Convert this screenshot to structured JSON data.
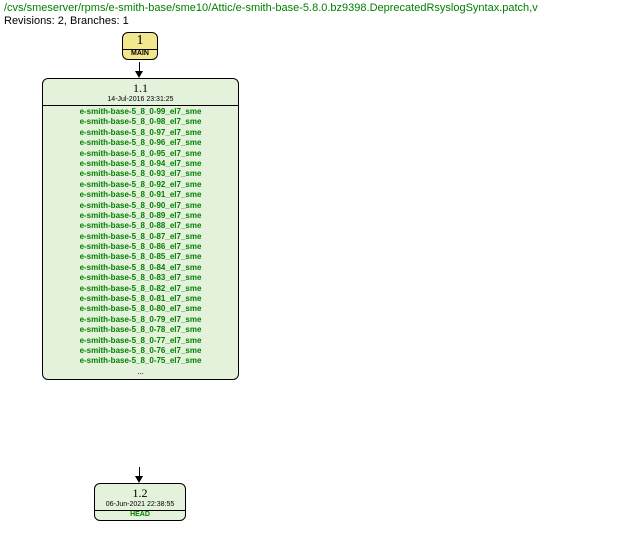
{
  "header": {
    "path": "/cvs/smeserver/rpms/e-smith-base/sme10/Attic/e-smith-base-5.8.0.bz9398.DeprecatedRsyslogSyntax.patch,v",
    "stats": "Revisions: 2, Branches: 1"
  },
  "nodes": {
    "branch": {
      "number": "1",
      "label": "MAIN"
    },
    "rev1": {
      "number": "1.1",
      "date": "14-Jul-2016 23:31:25",
      "tags": [
        "e-smith-base-5_8_0-99_el7_sme",
        "e-smith-base-5_8_0-98_el7_sme",
        "e-smith-base-5_8_0-97_el7_sme",
        "e-smith-base-5_8_0-96_el7_sme",
        "e-smith-base-5_8_0-95_el7_sme",
        "e-smith-base-5_8_0-94_el7_sme",
        "e-smith-base-5_8_0-93_el7_sme",
        "e-smith-base-5_8_0-92_el7_sme",
        "e-smith-base-5_8_0-91_el7_sme",
        "e-smith-base-5_8_0-90_el7_sme",
        "e-smith-base-5_8_0-89_el7_sme",
        "e-smith-base-5_8_0-88_el7_sme",
        "e-smith-base-5_8_0-87_el7_sme",
        "e-smith-base-5_8_0-86_el7_sme",
        "e-smith-base-5_8_0-85_el7_sme",
        "e-smith-base-5_8_0-84_el7_sme",
        "e-smith-base-5_8_0-83_el7_sme",
        "e-smith-base-5_8_0-82_el7_sme",
        "e-smith-base-5_8_0-81_el7_sme",
        "e-smith-base-5_8_0-80_el7_sme",
        "e-smith-base-5_8_0-79_el7_sme",
        "e-smith-base-5_8_0-78_el7_sme",
        "e-smith-base-5_8_0-77_el7_sme",
        "e-smith-base-5_8_0-76_el7_sme",
        "e-smith-base-5_8_0-75_el7_sme"
      ],
      "ellipsis": "..."
    },
    "rev2": {
      "number": "1.2",
      "date": "06-Jun-2021 22:38:55",
      "label": "HEAD"
    }
  }
}
